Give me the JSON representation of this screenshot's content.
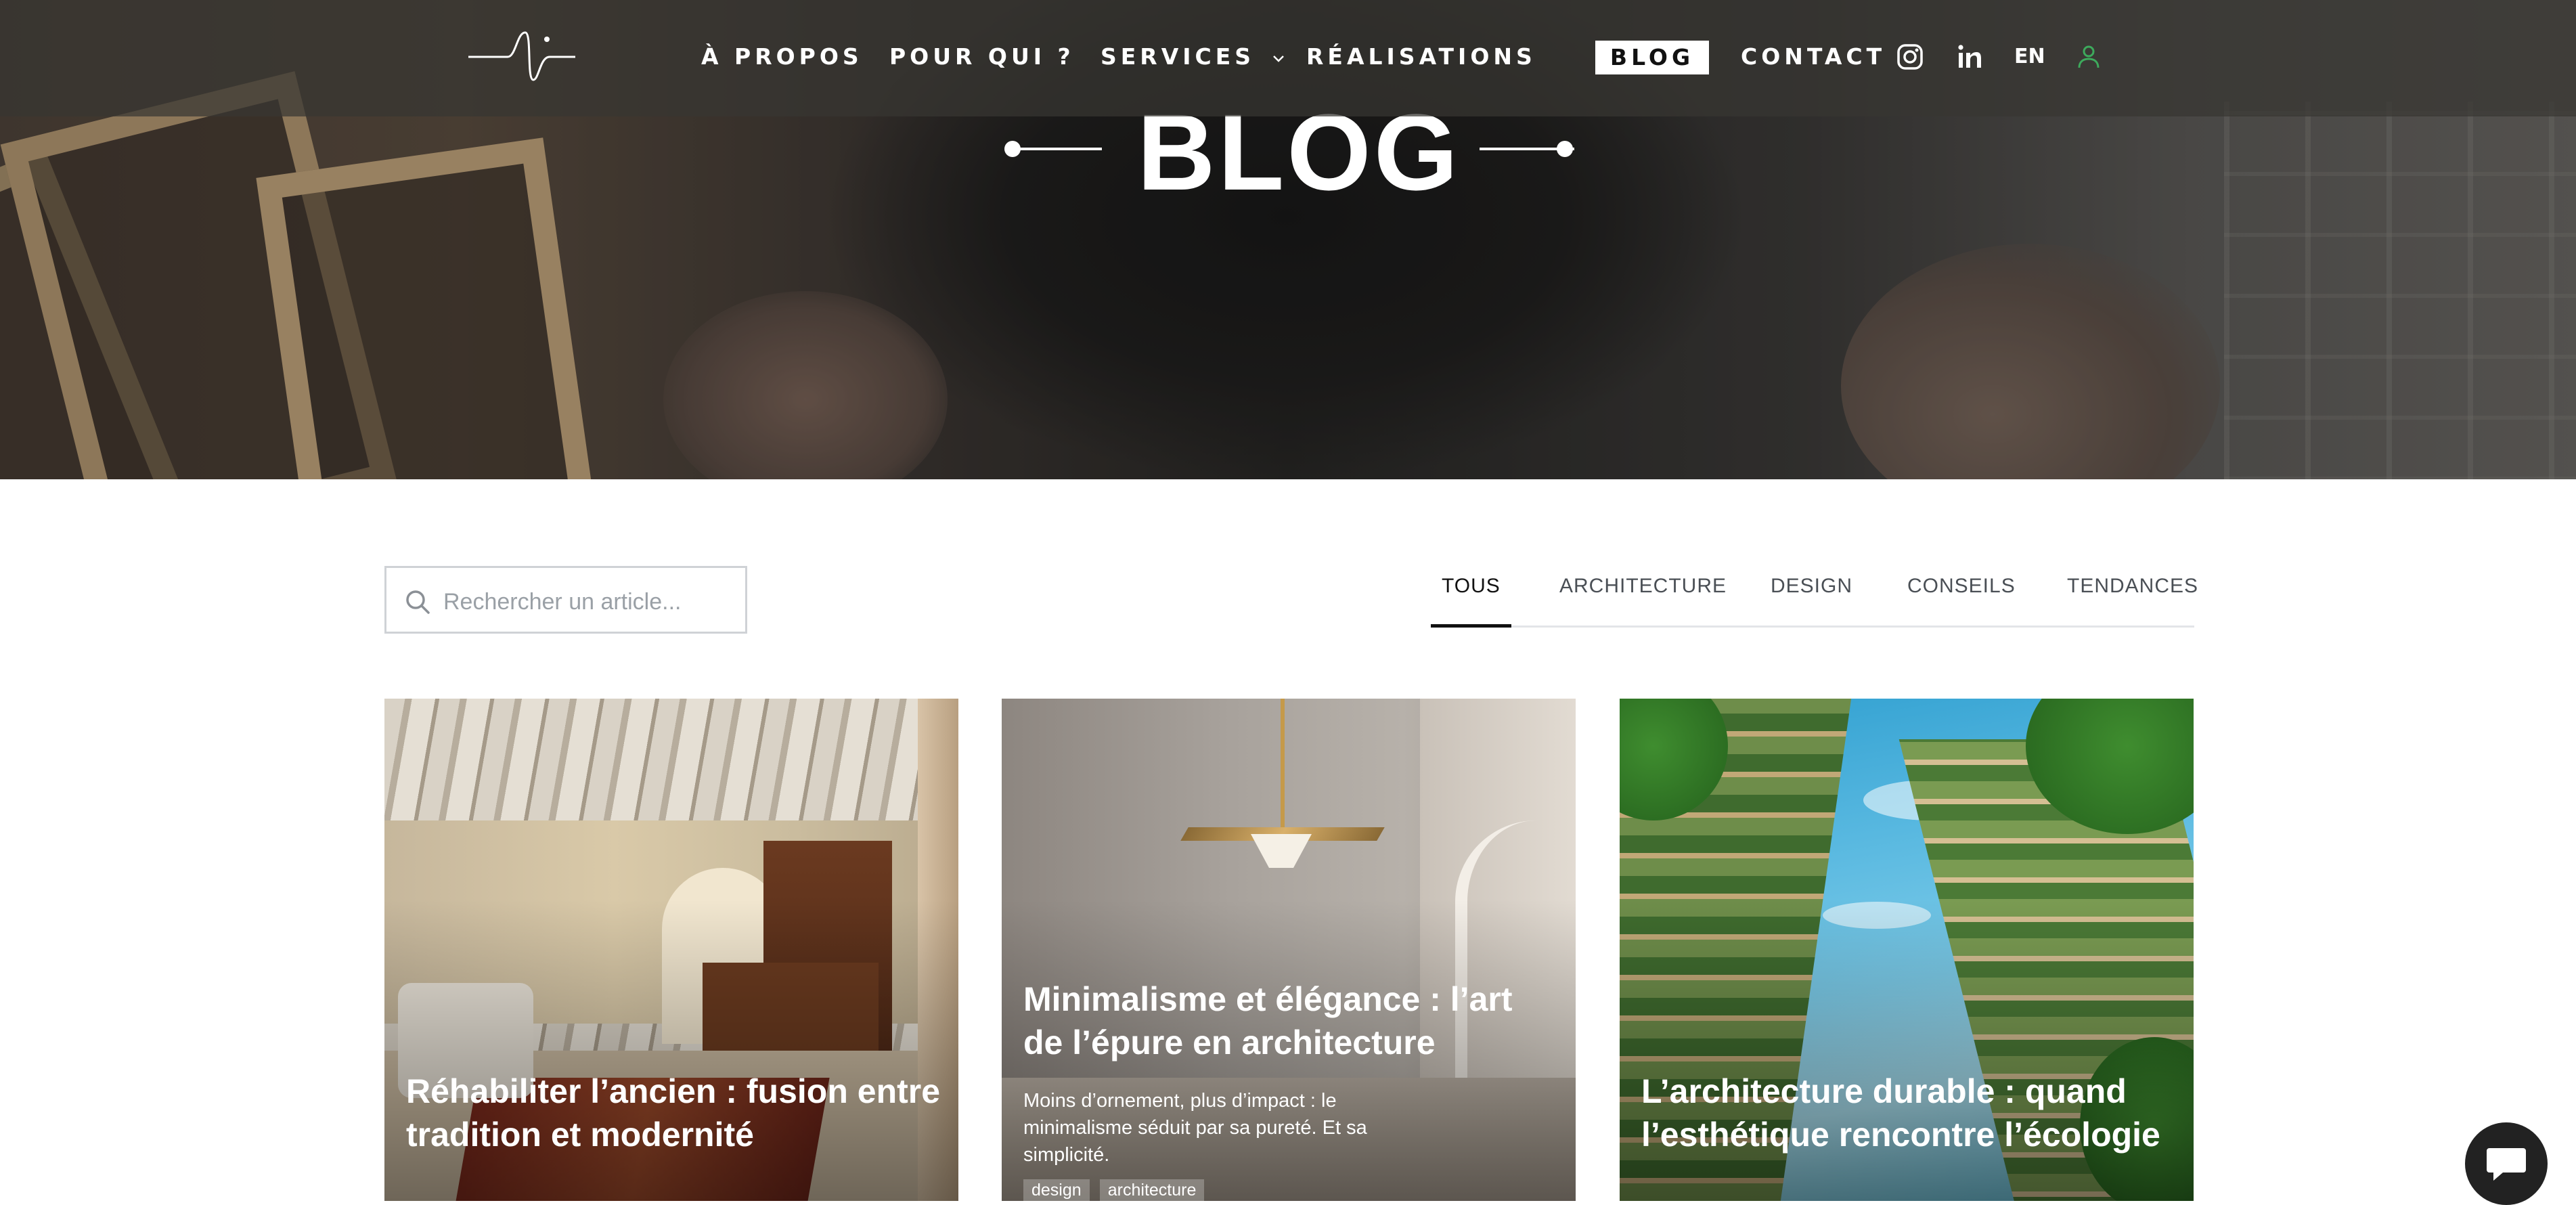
{
  "nav": {
    "items": [
      "À PROPOS",
      "POUR QUI ?",
      "SERVICES",
      "RÉALISATIONS"
    ],
    "blog": "BLOG",
    "contact": "CONTACT",
    "lang": "EN",
    "icons": [
      "instagram-icon",
      "linkedin-icon",
      "user-icon"
    ],
    "user_icon_color": "#3daa5c"
  },
  "hero": {
    "title": "BLOG"
  },
  "search": {
    "placeholder": "Rechercher un article..."
  },
  "tabs": [
    "TOUS",
    "ARCHITECTURE",
    "DESIGN",
    "CONSEILS",
    "TENDANCES"
  ],
  "active_tab": "TOUS",
  "cards": [
    {
      "title": "Réhabiliter l’ancien : fusion entre tradition et modernité"
    },
    {
      "title": "Minimalisme et élégance : l’art de l’épure en architecture",
      "excerpt": "Moins d’ornement, plus d’impact : le minimalisme séduit par sa pureté. Et sa simplicité.",
      "tags": [
        "design",
        "architecture"
      ]
    },
    {
      "title": "L’architecture durable : quand l’esthétique rencontre l’écologie"
    }
  ],
  "chat": {
    "icon": "chat-icon"
  }
}
